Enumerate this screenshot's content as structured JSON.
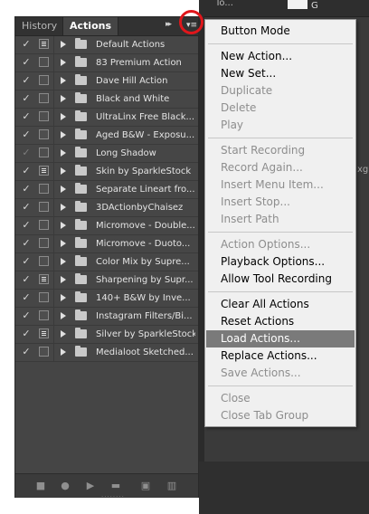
{
  "app_bg": {
    "tool_label": "To...",
    "channel_label": "G",
    "peek_text": "xgr"
  },
  "panel": {
    "tabs": [
      {
        "label": "History"
      },
      {
        "label": "Actions"
      }
    ],
    "collapse_glyph": "▸▸",
    "menu_button_glyph": "▾≡",
    "actions": [
      {
        "name": "Default Actions",
        "checked": true,
        "dialog": true
      },
      {
        "name": "83 Premium Action",
        "checked": true,
        "dialog": false
      },
      {
        "name": "Dave Hill Action",
        "checked": true,
        "dialog": false
      },
      {
        "name": "Black and White",
        "checked": true,
        "dialog": false
      },
      {
        "name": "UltraLinx Free Black...",
        "checked": true,
        "dialog": false
      },
      {
        "name": "Aged B&W - Exposu...",
        "checked": true,
        "dialog": false
      },
      {
        "name": "Long Shadow",
        "checked": "dim",
        "dialog": false
      },
      {
        "name": "Skin by SparkleStock",
        "checked": true,
        "dialog": true
      },
      {
        "name": "Separate Lineart fro...",
        "checked": true,
        "dialog": false
      },
      {
        "name": "3DActionbyChaisez",
        "checked": true,
        "dialog": false
      },
      {
        "name": "Micromove - Double...",
        "checked": true,
        "dialog": false
      },
      {
        "name": "Micromove - Duoto...",
        "checked": true,
        "dialog": false
      },
      {
        "name": "Color Mix by Supre...",
        "checked": true,
        "dialog": false
      },
      {
        "name": "Sharpening by Supr...",
        "checked": true,
        "dialog": true
      },
      {
        "name": "140+ B&W by Inve...",
        "checked": true,
        "dialog": false
      },
      {
        "name": "Instagram Filters/Bi...",
        "checked": true,
        "dialog": false
      },
      {
        "name": "Silver by SparkleStock",
        "checked": true,
        "dialog": true
      },
      {
        "name": "Medialoot Sketched...",
        "checked": true,
        "dialog": false
      }
    ],
    "bottom_icons": [
      "stop-icon",
      "record-icon",
      "play-icon",
      "new-set-icon",
      "new-action-icon",
      "delete-icon"
    ]
  },
  "menu": {
    "items": [
      {
        "label": "Button Mode",
        "enabled": true
      },
      {
        "sep": true
      },
      {
        "label": "New Action...",
        "enabled": true
      },
      {
        "label": "New Set...",
        "enabled": true
      },
      {
        "label": "Duplicate",
        "enabled": false
      },
      {
        "label": "Delete",
        "enabled": false
      },
      {
        "label": "Play",
        "enabled": false
      },
      {
        "sep": true
      },
      {
        "label": "Start Recording",
        "enabled": false
      },
      {
        "label": "Record Again...",
        "enabled": false
      },
      {
        "label": "Insert Menu Item...",
        "enabled": false
      },
      {
        "label": "Insert Stop...",
        "enabled": false
      },
      {
        "label": "Insert Path",
        "enabled": false
      },
      {
        "sep": true
      },
      {
        "label": "Action Options...",
        "enabled": false
      },
      {
        "label": "Playback Options...",
        "enabled": true
      },
      {
        "label": "Allow Tool Recording",
        "enabled": true
      },
      {
        "sep": true
      },
      {
        "label": "Clear All Actions",
        "enabled": true
      },
      {
        "label": "Reset Actions",
        "enabled": true
      },
      {
        "label": "Load Actions...",
        "enabled": true,
        "highlighted": true
      },
      {
        "label": "Replace Actions...",
        "enabled": true
      },
      {
        "label": "Save Actions...",
        "enabled": false
      },
      {
        "sep": true
      },
      {
        "label": "Close",
        "enabled": false
      },
      {
        "label": "Close Tab Group",
        "enabled": false
      }
    ]
  },
  "colors": {
    "highlight_circle": "#e0161b",
    "menu_highlight": "#7a7a7a",
    "panel_bg": "#454545"
  }
}
